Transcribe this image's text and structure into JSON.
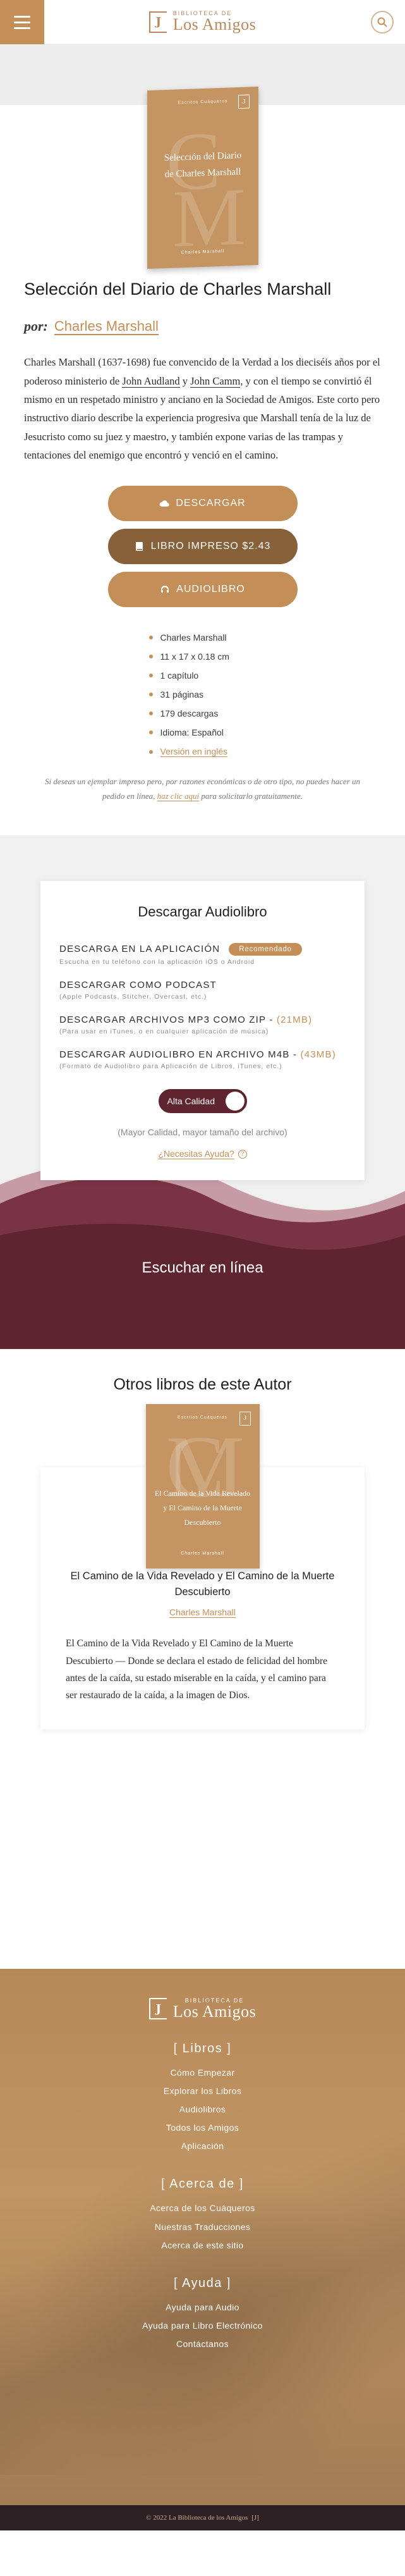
{
  "header": {
    "logo_small": "Biblioteca de",
    "logo_big": "Los Amigos"
  },
  "book": {
    "series": "Escritos Cuáqueros",
    "cover_title": "Selección del Diario de Charles Marshall",
    "cover_author": "Charles Marshall",
    "title": "Selección del Diario de Charles Marshall",
    "por": "por:",
    "author": "Charles Marshall",
    "desc_before": "Charles Marshall (1637-1698) fue convencido de la Verdad a los dieciséis años por el poderoso ministerio de ",
    "desc_link1": "John Audland",
    "desc_mid": " y ",
    "desc_link2": "John Camm",
    "desc_after": ", y con el tiempo se convirtió él mismo en un respetado ministro y anciano en la Sociedad de Amigos. Este corto pero instructivo diario describe la experiencia progresiva que Marshall tenía de la luz de Jesucristo como su juez y maestro, y también expone varias de las trampas y tentaciones del enemigo que encontró y venció en el camino."
  },
  "buttons": {
    "download": "Descargar",
    "print": "Libro Impreso $2.43",
    "audio": "Audiolibro"
  },
  "details": [
    "Charles Marshall",
    "11 x 17 x 0.18 cm",
    "1 capítulo",
    "31 páginas",
    "179 descargas",
    "Idioma: Español"
  ],
  "english_version": "Versión en inglés",
  "notice": {
    "before": "Si deseas un ejemplar impreso pero, por razones económicas o de otro tipo, no puedes hacer un pedido en línea, ",
    "link": "haz clic aquí",
    "after": " para solicitarlo gratuitamente."
  },
  "audio": {
    "title": "Descargar Audiolibro",
    "options": [
      {
        "label": "Descarga en la Aplicación",
        "badge": "Recomendado",
        "size": "",
        "sub": "Escucha en tu teléfono con la aplicación iOS o Android"
      },
      {
        "label": "Descargar como Podcast",
        "badge": "",
        "size": "",
        "sub": "(Apple Podcasts, Stitcher, Overcast, etc.)"
      },
      {
        "label": "Descargar Archivos MP3 como ZIP - ",
        "badge": "",
        "size": "(21MB)",
        "sub": "(Para usar en iTunes, o en cualquier aplicación de música)"
      },
      {
        "label": "Descargar Audiolibro en Archivo M4B - ",
        "badge": "",
        "size": "(43MB)",
        "sub": "(Formato de Audiolibro para Aplicación de Libros, iTunes, etc.)"
      }
    ],
    "toggle_label": "Alta Calidad",
    "quality_note": "(Mayor Calidad, mayor tamaño del archivo)",
    "help": "¿Necesitas Ayuda?",
    "listen": "Escuchar en línea"
  },
  "others": {
    "title": "Otros libros de este Autor",
    "card": {
      "series": "Escritos Cuáqueros",
      "cover_title": "El Camino de la Vida Revelado y El Camino de la Muerte Descubierto",
      "cover_author": "Charles Marshall",
      "title": "El Camino de la Vida Revelado y El Camino de la Muerte Descubierto",
      "author": "Charles Marshall",
      "desc": "El Camino de la Vida Revelado y El Camino de la Muerte Descubierto — Donde se declara el estado de felicidad del hombre antes de la caída, su estado miserable en la caída, y el camino para ser restaurado de la caída, a la imagen de Dios."
    }
  },
  "footer": {
    "logo_small": "Biblioteca de",
    "logo_big": "Los Amigos",
    "groups": [
      {
        "head": "Libros",
        "links": [
          "Cómo Empezar",
          "Explorar los Libros",
          "Audiolibros",
          "Todos los Amigos",
          "Aplicación"
        ]
      },
      {
        "head": "Acerca de",
        "links": [
          "Acerca de los Cuáqueros",
          "Nuestras Traducciones",
          "Acerca de este sitio"
        ]
      },
      {
        "head": "Ayuda",
        "links": [
          "Ayuda para Audio",
          "Ayuda para Libro Electrónico",
          "Contáctanos"
        ]
      }
    ],
    "copyright": "© 2022 La Biblioteca de los Amigos"
  },
  "colors": {
    "accent": "#c38e58",
    "accent_dark": "#86613a",
    "maroon": "#5e2430",
    "footer_bar": "#2d2126"
  }
}
